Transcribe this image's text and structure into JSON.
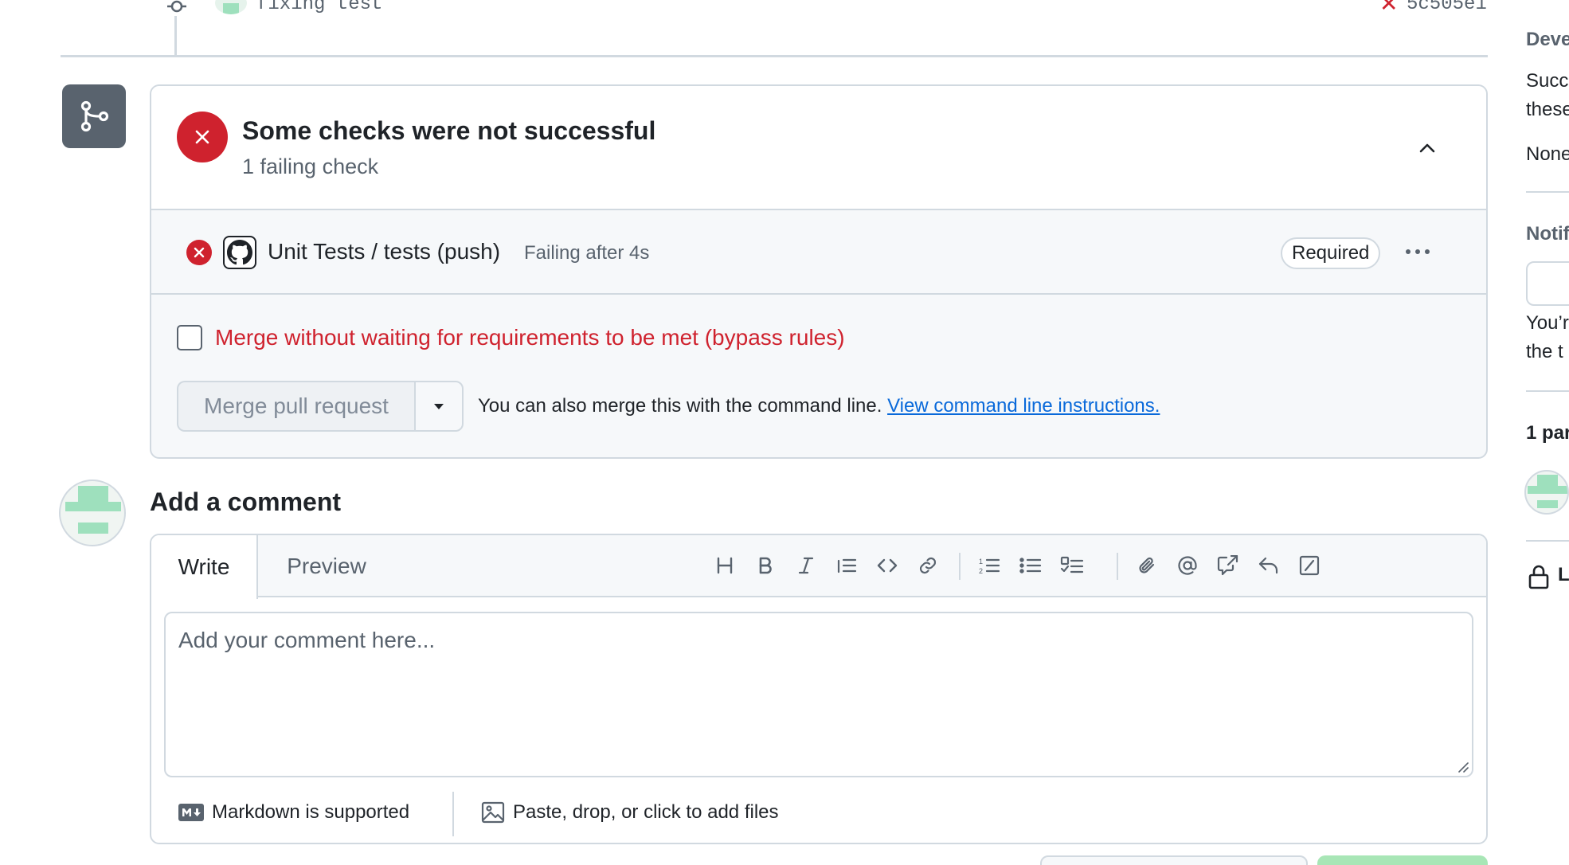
{
  "commit": {
    "message": "fixing test",
    "status_glyph": "✕",
    "sha": "5c505e1"
  },
  "merge_box": {
    "title": "Some checks were not successful",
    "subtitle": "1 failing check",
    "check": {
      "name": "Unit Tests / tests (push)",
      "status": "Failing after 4s",
      "badge": "Required"
    },
    "bypass_label": "Merge without waiting for requirements to be met (bypass rules)",
    "merge_button": "Merge pull request",
    "cli_text": "You can also merge this with the command line.",
    "cli_link": "View command line instructions."
  },
  "comment": {
    "title": "Add a comment",
    "tabs": {
      "write": "Write",
      "preview": "Preview"
    },
    "placeholder": "Add your comment here...",
    "markdown_note": "Markdown is supported",
    "files_note": "Paste, drop, or click to add files",
    "toolbar": [
      "heading-icon",
      "bold-icon",
      "italic-icon",
      "quote-icon",
      "code-icon",
      "link-icon",
      "numbered-list-icon",
      "bulleted-list-icon",
      "task-list-icon",
      "attach-icon",
      "mention-icon",
      "reference-icon",
      "reply-icon",
      "slash-command-icon"
    ]
  },
  "sidebar": {
    "dev_heading": "Deve",
    "dev_line1": "Succ",
    "dev_line2": "these",
    "dev_none": "None",
    "notif_heading": "Notif",
    "notif_line1": "You’r",
    "notif_line2": "the t",
    "participants": "1 par",
    "lock_text": "L"
  },
  "colors": {
    "danger": "#cf222e",
    "link": "#0969da",
    "muted": "#59636e",
    "border": "#d1d9e0"
  }
}
